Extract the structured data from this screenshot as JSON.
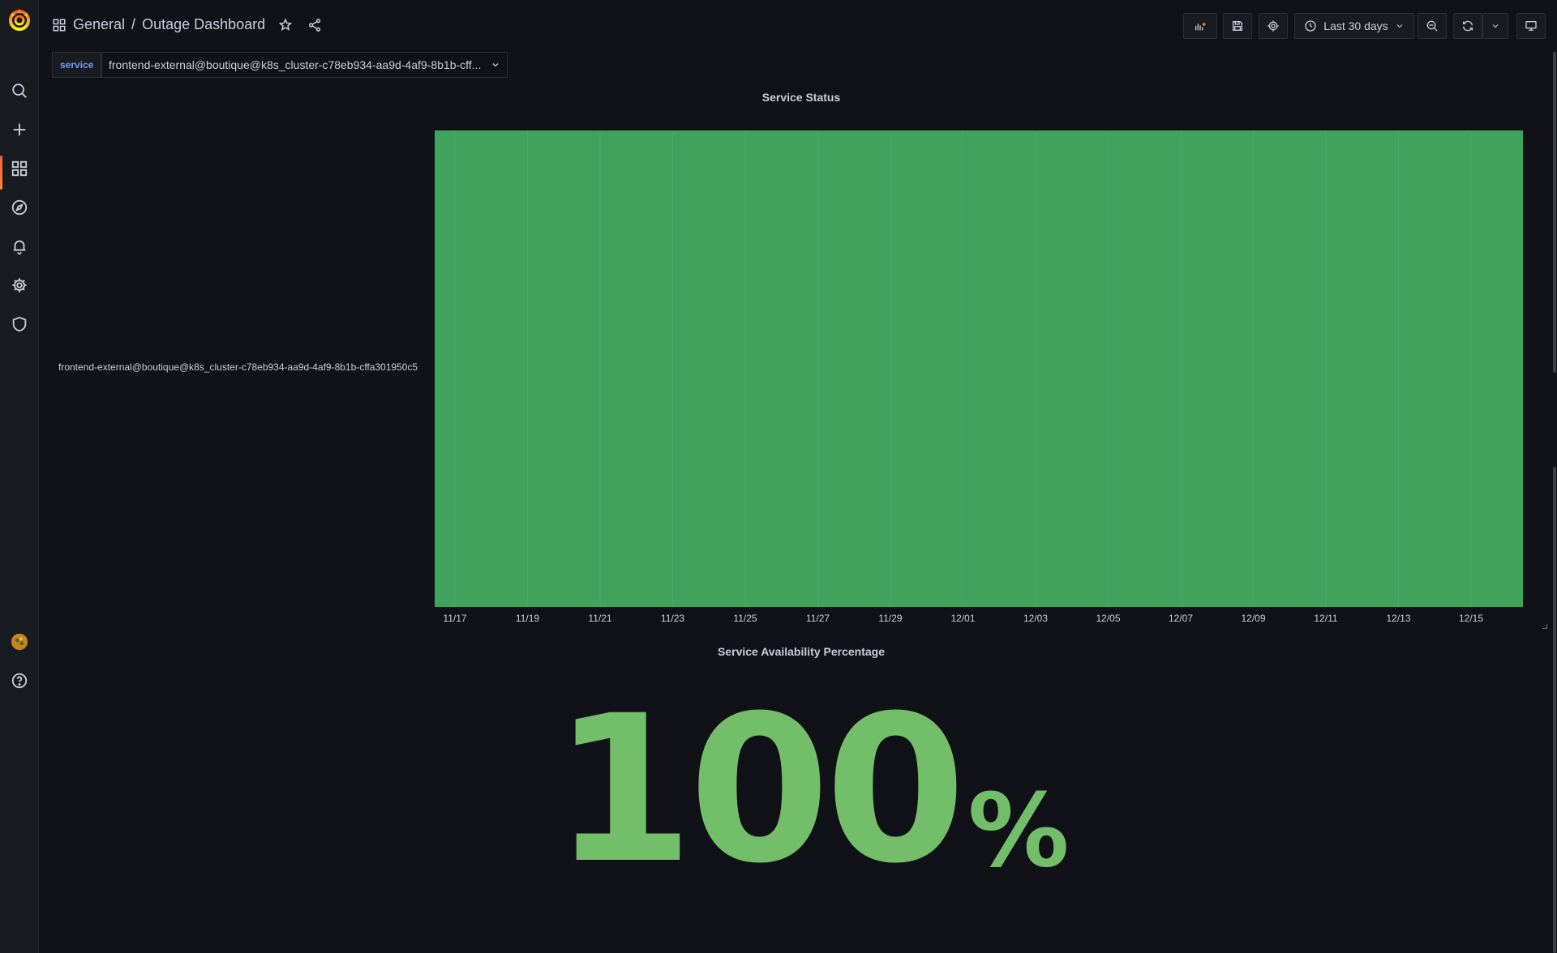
{
  "sidebar": {
    "items": [
      {
        "name": "search-icon"
      },
      {
        "name": "plus-icon"
      },
      {
        "name": "dashboards-icon",
        "active": true
      },
      {
        "name": "compass-icon"
      },
      {
        "name": "bell-icon"
      },
      {
        "name": "gear-icon"
      },
      {
        "name": "shield-icon"
      }
    ],
    "bottom": [
      {
        "name": "avatar"
      },
      {
        "name": "help-icon"
      }
    ]
  },
  "header": {
    "folder": "General",
    "separator": "/",
    "title": "Outage Dashboard",
    "time_range": "Last 30 days"
  },
  "variables": {
    "label": "service",
    "value": "frontend-external@boutique@k8s_cluster-c78eb934-aa9d-4af9-8b1b-cff..."
  },
  "panels": {
    "status": {
      "title": "Service Status",
      "row_label": "frontend-external@boutique@k8s_cluster-c78eb934-aa9d-4af9-8b1b-cffa301950c5",
      "x_ticks": [
        "11/17",
        "11/19",
        "11/21",
        "11/23",
        "11/25",
        "11/27",
        "11/29",
        "12/01",
        "12/03",
        "12/05",
        "12/07",
        "12/09",
        "12/11",
        "12/13",
        "12/15"
      ],
      "state_color": "#3fa35e"
    },
    "availability": {
      "title": "Service Availability Percentage",
      "value": "100",
      "unit": "%",
      "color": "#73bf69"
    }
  }
}
